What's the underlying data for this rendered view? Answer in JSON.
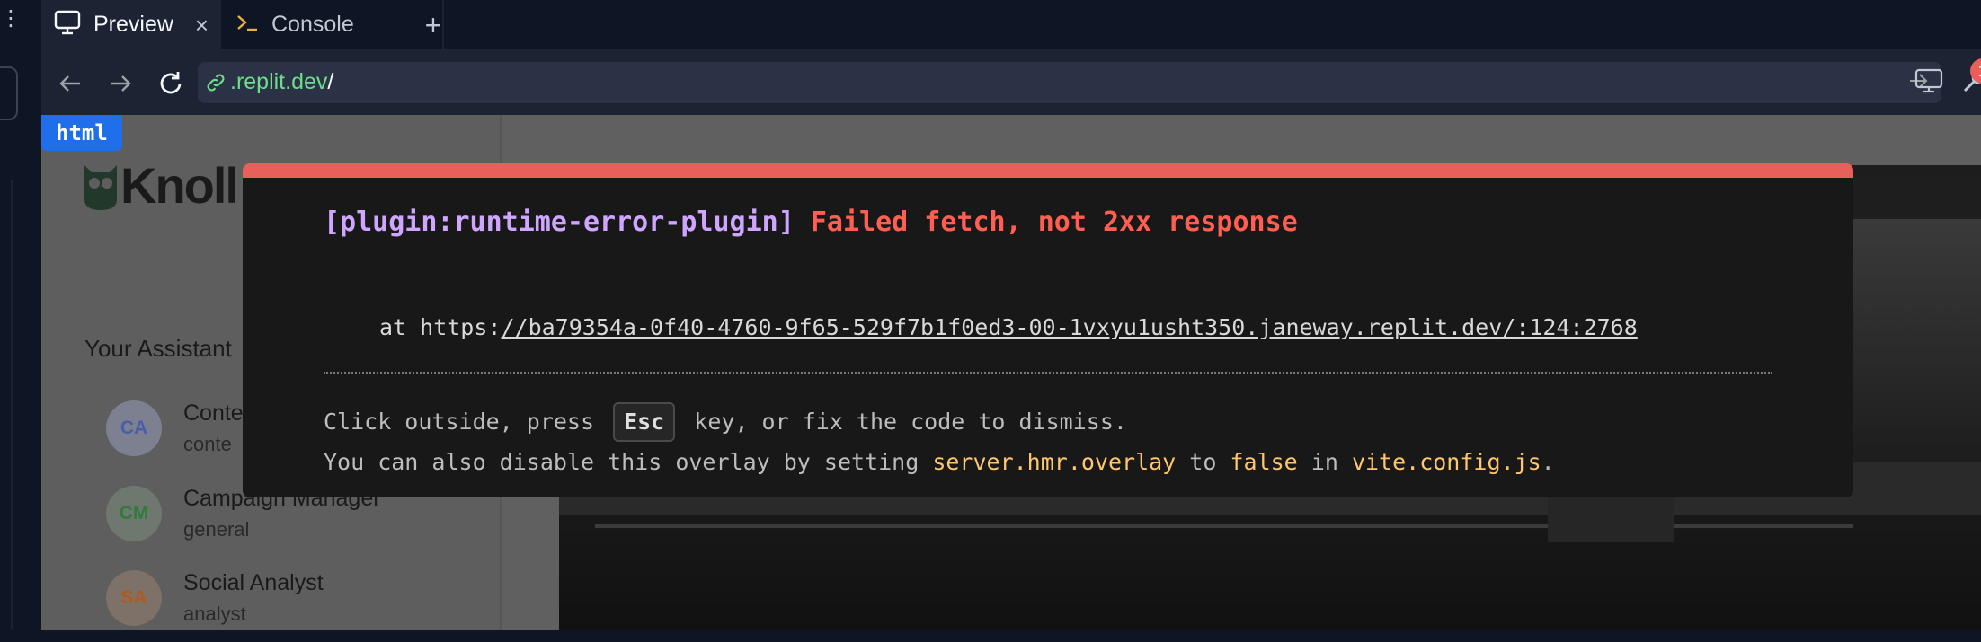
{
  "tabs": [
    {
      "label": "Preview",
      "icon": "monitor-icon",
      "close": "×"
    },
    {
      "label": "Console",
      "icon": "terminal-icon"
    }
  ],
  "new_tab_label": "+",
  "address": {
    "host": ".replit.dev",
    "path": "/"
  },
  "notification_badge": "1",
  "element_tag": "html",
  "sidebar": {
    "logo_text": "Knoll",
    "section_title": "Your Assistant",
    "assistants": [
      {
        "initials": "CA",
        "name": "Conte",
        "role": "conte",
        "color": "#4a5da8",
        "bg": "#7d8090"
      },
      {
        "initials": "CM",
        "name": "Campaign Manager",
        "role": "general",
        "color": "#2e7d3a",
        "bg": "#6f786f"
      },
      {
        "initials": "SA",
        "name": "Social Analyst",
        "role": "analyst",
        "color": "#b05a20",
        "bg": "#7d7168"
      }
    ]
  },
  "error_overlay": {
    "plugin": "[plugin:runtime-error-plugin]",
    "message": "Failed fetch, not 2xx response",
    "stack_prefix": "at https:",
    "stack_url": "//ba79354a-0f40-4760-9f65-529f7b1f0ed3-00-1vxyu1usht350.janeway.replit.dev/:124:2768",
    "tip1_before": "Click outside, press ",
    "tip1_key": "Esc",
    "tip1_after": " key, or fix the code to dismiss.",
    "tip2_a": "You can also disable this overlay by setting ",
    "tip2_code1": "server.hmr.overlay",
    "tip2_b": " to ",
    "tip2_code2": "false",
    "tip2_c": " in ",
    "tip2_code3": "vite.config.js",
    "tip2_d": "."
  }
}
